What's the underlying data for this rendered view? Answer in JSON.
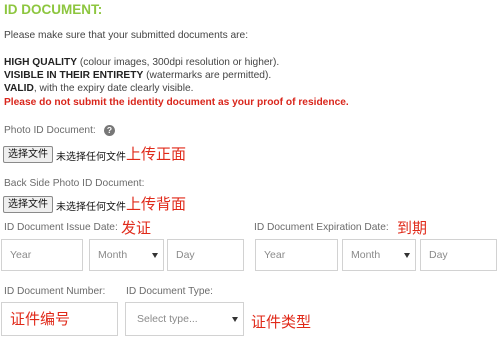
{
  "header": {
    "title": "ID DOCUMENT:"
  },
  "intro": "Please make sure that your submitted documents are:",
  "requirements": [
    {
      "bold": "HIGH QUALITY",
      "rest": " (colour images, 300dpi resolution or higher)."
    },
    {
      "bold": "VISIBLE IN THEIR ENTIRETY",
      "rest": " (watermarks are permitted)."
    },
    {
      "bold": "VALID",
      "rest": ", with the expiry date clearly visible."
    }
  ],
  "warning": "Please do not submit the identity document as your proof of residence.",
  "photo_id": {
    "label": "Photo ID Document:",
    "help": "?",
    "button": "选择文件",
    "no_file": "未选择任何文件",
    "annotation": "上传正面"
  },
  "back_side": {
    "label": "Back Side Photo ID Document:",
    "button": "选择文件",
    "no_file": "未选择任何文件",
    "annotation": "上传背面"
  },
  "issue_date": {
    "label": "ID Document Issue Date:",
    "annotation": "发证",
    "year_placeholder": "Year",
    "month_value": "Month",
    "day_placeholder": "Day"
  },
  "expiration_date": {
    "label": "ID Document Expiration Date:",
    "annotation": "到期",
    "year_placeholder": "Year",
    "month_value": "Month",
    "day_placeholder": "Day"
  },
  "doc_number": {
    "label": "ID Document Number:",
    "annotation": "证件编号"
  },
  "doc_type": {
    "label": "ID Document Type:",
    "select_value": "Select type...",
    "annotation": "证件类型"
  },
  "colors": {
    "title": "#8dc63f",
    "warning": "#d9261c",
    "annotation": "#e02a1a"
  }
}
